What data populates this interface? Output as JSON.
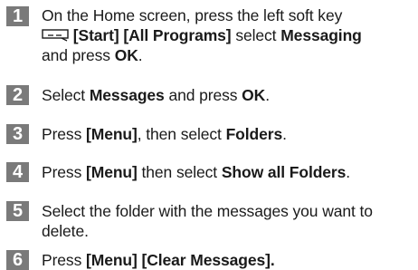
{
  "steps": [
    {
      "number": "1",
      "line1": "On the Home screen, press the left soft key",
      "start": "[Start]",
      "all_programs": "[All Programs]",
      "select_word": "select",
      "messaging": "Messaging",
      "and_press": "and press",
      "ok": "OK",
      "end": "."
    },
    {
      "number": "2",
      "select_word": "Select",
      "messages": "Messages",
      "and_press": "and press",
      "ok": "OK",
      "end": "."
    },
    {
      "number": "3",
      "press_word": "Press",
      "menu": "[Menu]",
      "then_select": ", then select",
      "folders": "Folders",
      "end": "."
    },
    {
      "number": "4",
      "press_word": "Press",
      "menu": "[Menu]",
      "then_select": "then select",
      "show_all": "Show all Folders",
      "end": "."
    },
    {
      "number": "5",
      "text": "Select the folder with the messages you want to delete."
    },
    {
      "number": "6",
      "press_word": "Press",
      "menu_clear": "[Menu] [Clear Messages]",
      "end": "."
    }
  ],
  "icons": {
    "softkey": "left-softkey-icon"
  },
  "colors": {
    "badge": "#7a7a7a",
    "text": "#1a1a1a"
  }
}
